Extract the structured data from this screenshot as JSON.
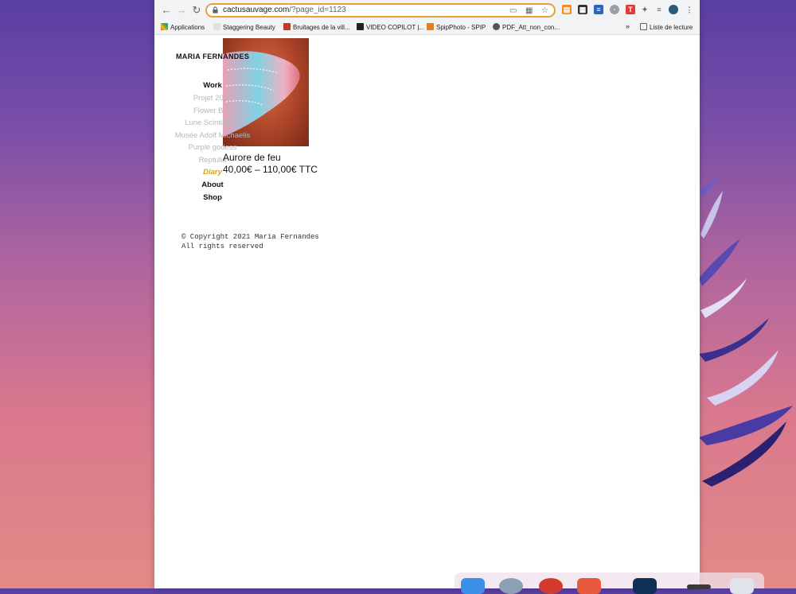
{
  "browser": {
    "url_host": "cactusauvage.com",
    "url_path": "/?page_id=1123",
    "bookmarks": [
      {
        "label": "Applications"
      },
      {
        "label": "Staggering Beauty"
      },
      {
        "label": "Bruitages de la vill..."
      },
      {
        "label": "VIDEO COPILOT |..."
      },
      {
        "label": "SpipPhoto - SPIP"
      },
      {
        "label": "PDF_Att_non_con..."
      }
    ],
    "more_bookmarks": "»",
    "reading_list": "Liste de lecture"
  },
  "site": {
    "title": "MARIA FERNANDES",
    "menu": {
      "work": "Work",
      "sub": [
        "Projet 2020",
        "Flower Bed",
        "Lune Scintillante",
        "Musée Adolf Michaelis",
        "Purple godess",
        "Reptulia"
      ],
      "diary": "Diary",
      "about": "About",
      "shop": "Shop"
    },
    "product": {
      "name": "Aurore de feu",
      "price": "40,00€ – 110,00€ TTC"
    },
    "footer": {
      "line1": "© Copyright 2021 Maria Fernandes",
      "line2": "All rights reserved"
    }
  },
  "colors": {
    "active_menu": "#d6a11e",
    "omnibox_border": "#e8a13a"
  }
}
